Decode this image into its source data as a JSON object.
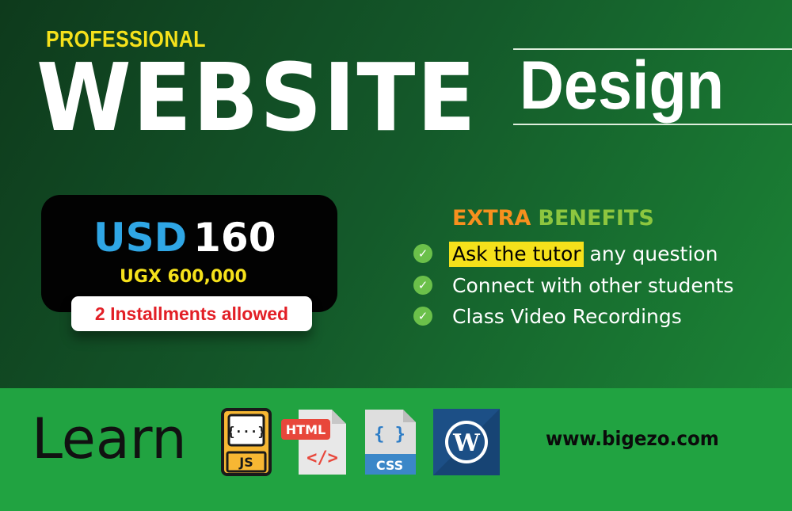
{
  "header": {
    "eyebrow": "PROFESSIONAL",
    "headline": "WEBSITE",
    "subheadline": "Design"
  },
  "pricing": {
    "currency": "USD",
    "amount": "160",
    "alt_price": "UGX 600,000",
    "installments": "2 Installments allowed"
  },
  "benefits": {
    "title_part1": "EXTRA",
    "title_part2": "BENEFITS",
    "items": [
      {
        "highlight": "Ask the tutor",
        "text": " any question"
      },
      {
        "text": "Connect with other students"
      },
      {
        "text": "Class Video Recordings"
      }
    ]
  },
  "footer": {
    "learn_label": "Learn",
    "website": "www.bigezo.com",
    "icons": [
      {
        "name": "javascript-file-icon",
        "label": "JS",
        "glyph": "{···}"
      },
      {
        "name": "html-file-icon",
        "label": "HTML",
        "glyph": "</>"
      },
      {
        "name": "css-file-icon",
        "label": "CSS",
        "glyph": "{ }"
      },
      {
        "name": "wordpress-icon",
        "glyph": "W"
      }
    ]
  },
  "colors": {
    "eyebrow": "#f5e11b",
    "usd": "#2fa6e5",
    "installments_text": "#e21f26",
    "extra": "#f7901e",
    "benefits": "#8dc63f",
    "check": "#6bc04a",
    "band": "#21a341"
  }
}
